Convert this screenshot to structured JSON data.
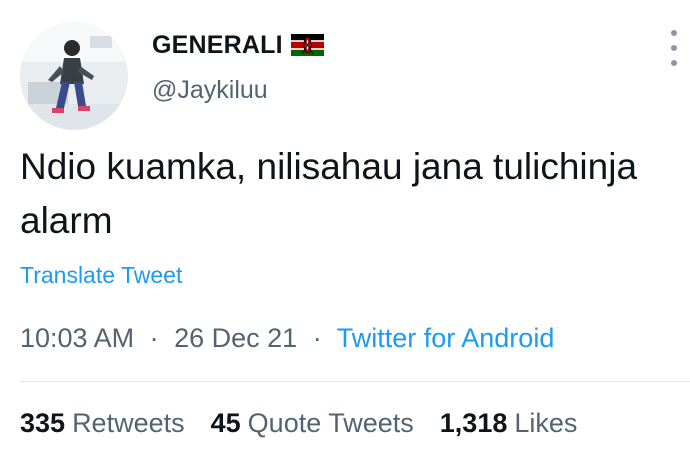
{
  "tweet": {
    "display_name": "GENERALI",
    "flag_icon": "kenya-flag-icon",
    "handle": "@Jaykiluu",
    "text": "Ndio kuamka, nilisahau jana tulichinja alarm",
    "translate_label": "Translate Tweet",
    "time": "10:03 AM",
    "separator": "·",
    "date": "26 Dec 21",
    "source": "Twitter for Android",
    "more_icon": "more-vertical-icon"
  },
  "stats": [
    {
      "count": "335",
      "label": "Retweets"
    },
    {
      "count": "45",
      "label": "Quote Tweets"
    },
    {
      "count": "1,318",
      "label": "Likes"
    }
  ],
  "colors": {
    "accent": "#1d9bf0",
    "text_primary": "#0f1419",
    "text_secondary": "#536471",
    "divider": "#e1e8ed"
  }
}
